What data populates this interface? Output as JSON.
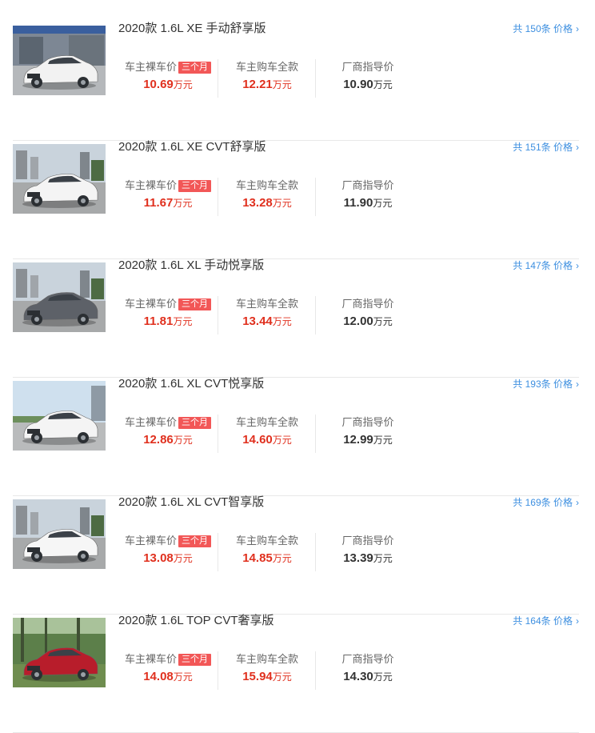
{
  "common": {
    "naked_label": "车主裸车价",
    "badge": "三个月",
    "full_label": "车主购车全款",
    "guide_label": "厂商指导价",
    "unit": "万元",
    "more_prefix": "共 ",
    "more_suffix": "条 价格"
  },
  "items": [
    {
      "title": "2020款 1.6L XE 手动舒享版",
      "count": "150",
      "naked": "10.69",
      "full": "12.21",
      "guide": "10.90",
      "car_color": "#f2f2f2",
      "bg": "office"
    },
    {
      "title": "2020款 1.6L XE CVT舒享版",
      "count": "151",
      "naked": "11.67",
      "full": "13.28",
      "guide": "11.90",
      "car_color": "#f4f4f4",
      "bg": "city"
    },
    {
      "title": "2020款 1.6L XL 手动悦享版",
      "count": "147",
      "naked": "11.81",
      "full": "13.44",
      "guide": "12.00",
      "car_color": "#5d6168",
      "bg": "city"
    },
    {
      "title": "2020款 1.6L XL CVT悦享版",
      "count": "193",
      "naked": "12.86",
      "full": "14.60",
      "guide": "12.99",
      "car_color": "#f4f4f4",
      "bg": "sky"
    },
    {
      "title": "2020款 1.6L XL CVT智享版",
      "count": "169",
      "naked": "13.08",
      "full": "14.85",
      "guide": "13.39",
      "car_color": "#f6f6f6",
      "bg": "city"
    },
    {
      "title": "2020款 1.6L TOP CVT奢享版",
      "count": "164",
      "naked": "14.08",
      "full": "15.94",
      "guide": "14.30",
      "car_color": "#b81d2b",
      "bg": "forest"
    }
  ]
}
